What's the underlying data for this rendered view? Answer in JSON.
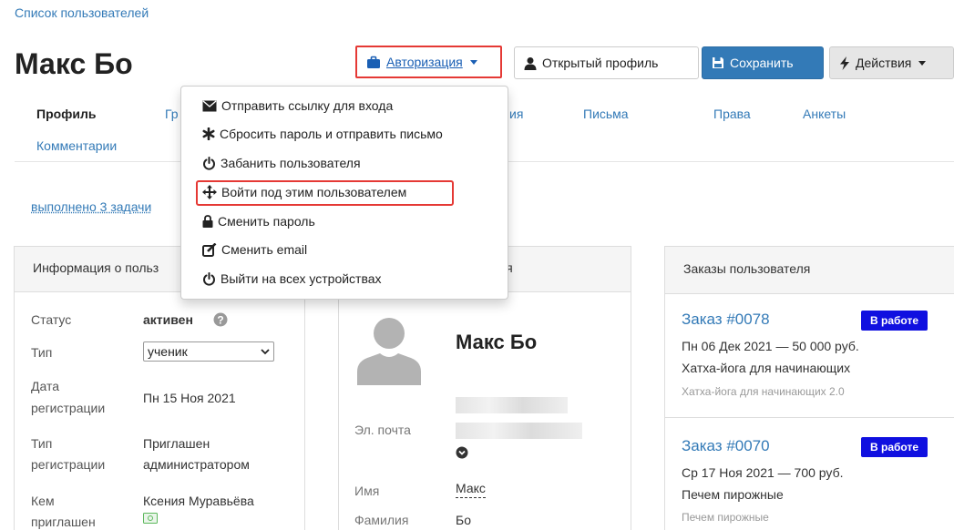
{
  "breadcrumb": "Список пользователей",
  "title": "Макс Бо",
  "toolbar": {
    "auth_label": "Авторизация",
    "profile_label": "Открытый профиль",
    "save_label": "Сохранить",
    "actions_label": "Действия"
  },
  "tabs": {
    "profile": "Профиль",
    "groups_partial": "Гр",
    "sessions_partial": "ия",
    "letters": "Письма",
    "rights": "Права",
    "forms": "Анкеты",
    "comments": "Комментарии"
  },
  "tasks_link": "выполнено 3 задачи",
  "auth_menu": {
    "items": [
      "Отправить ссылку для входа",
      "Сбросить пароль и отправить письмо",
      "Забанить пользователя",
      "Войти под этим пользователем",
      "Сменить пароль",
      "Сменить email",
      "Выйти на всех устройствах"
    ],
    "highlighted_index": 3
  },
  "info_panel": {
    "title": "Информация о польз",
    "status_label": "Статус",
    "status_value": "активен",
    "type_label": "Тип",
    "type_value": "ученик",
    "reg_date_label_1": "Дата",
    "reg_date_label_2": "регистрации",
    "reg_date_value": "Пн 15 Ноя 2021",
    "reg_type_label_1": "Тип",
    "reg_type_label_2": "регистрации",
    "reg_type_value_1": "Приглашен",
    "reg_type_value_2": "администратором",
    "invited_label_1": "Кем",
    "invited_label_2": "приглашен",
    "invited_value": "Ксения Муравьёва"
  },
  "profile_panel": {
    "title_partial": "ля",
    "name": "Макс Бо",
    "email_label": "Эл. почта",
    "first_name_label": "Имя",
    "first_name_value": "Макс",
    "last_name_label": "Фамилия",
    "last_name_value": "Бо"
  },
  "orders_panel": {
    "title": "Заказы пользователя",
    "orders": [
      {
        "number": "Заказ #0078",
        "status": "В работе",
        "date_price": "Пн 06 Дек 2021 — 50 000 руб.",
        "product": "Хатха-йога для начинающих",
        "offer": "Хатха-йога для начинающих 2.0"
      },
      {
        "number": "Заказ #0070",
        "status": "В работе",
        "date_price": "Ср 17 Ноя 2021 — 700 руб.",
        "product": "Печем пирожные",
        "offer": "Печем пирожные"
      }
    ]
  },
  "colors": {
    "link": "#337ab7",
    "primary": "#337ab7",
    "highlight_border": "#e53935",
    "status_badge": "#1010e0"
  }
}
